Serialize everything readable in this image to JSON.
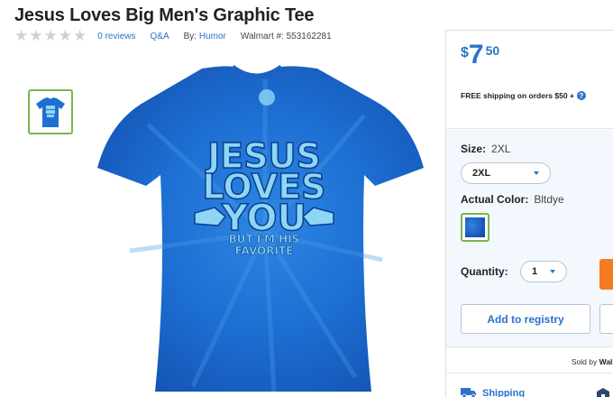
{
  "product": {
    "title": "Jesus Loves Big Men's Graphic Tee",
    "rating_stars": 0,
    "reviews_label": "0 reviews",
    "qa_label": "Q&A",
    "by_prefix": "By:",
    "brand": "Humor",
    "walmart_number": "Walmart #: 553162281"
  },
  "shirt_graphic": {
    "line1": "JESUS",
    "line2": "LOVES",
    "line3": "YOU",
    "line4": "BUT I'M HIS",
    "line5": "FAVORITE"
  },
  "price": {
    "currency": "$",
    "whole": "7",
    "cents": "50"
  },
  "shipping_note": "FREE shipping on orders $50 +",
  "size": {
    "label": "Size:",
    "current": "2XL",
    "selected": "2XL"
  },
  "color": {
    "label": "Actual Color:",
    "current": "Bltdye",
    "swatch_hex": "#1f6fd0"
  },
  "quantity": {
    "label": "Quantity:",
    "value": "1"
  },
  "registry_label": "Add to registry",
  "sold_by": {
    "prefix": "Sold by",
    "seller": "Walmar"
  },
  "fulfillment": {
    "shipping_label": "Shipping"
  },
  "colors": {
    "accent": "#2a73c9",
    "shirt": "#1f6fd0",
    "print": "#8fd6f5",
    "cart": "#f47b20",
    "selected_border": "#7ab648",
    "star_empty": "#d0d0d0"
  }
}
